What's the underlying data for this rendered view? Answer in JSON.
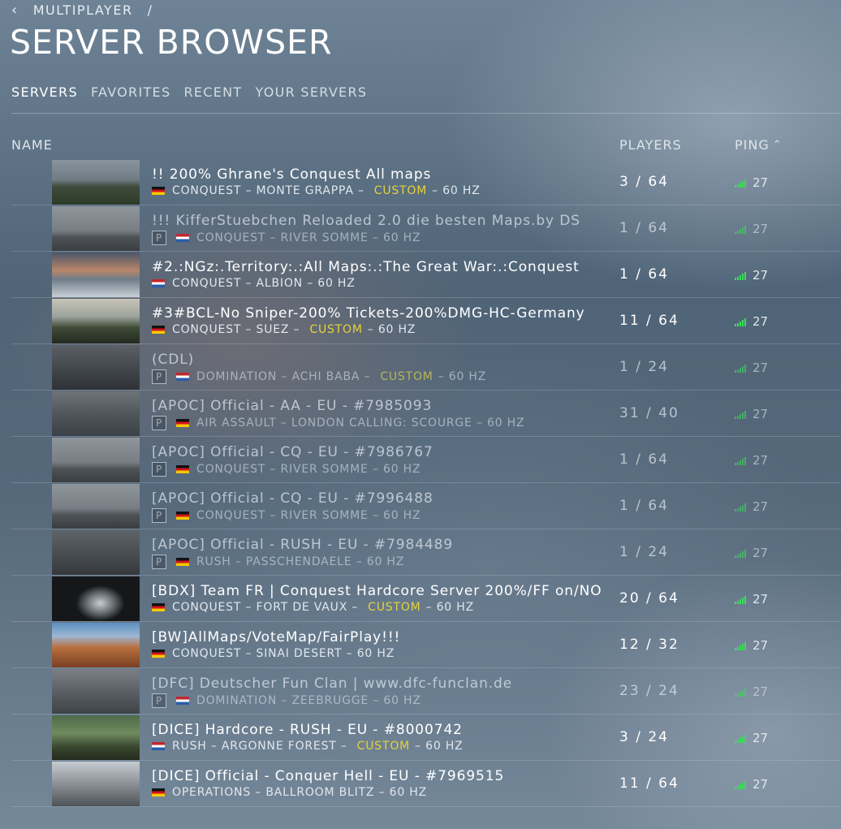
{
  "breadcrumb": {
    "back_icon": "chevron-left-icon",
    "label": "MULTIPLAYER",
    "separator": "/"
  },
  "page_title": "SERVER BROWSER",
  "tabs": [
    {
      "label": "SERVERS",
      "active": true
    },
    {
      "label": "FAVORITES",
      "active": false
    },
    {
      "label": "RECENT",
      "active": false
    },
    {
      "label": "YOUR SERVERS",
      "active": false
    }
  ],
  "columns": {
    "name": "NAME",
    "players": "PLAYERS",
    "ping": "PING",
    "ping_sort_icon": "chevron-up-icon"
  },
  "accent": {
    "custom": "#e6d23a",
    "ping_bars": "#3ddc5a"
  },
  "servers": [
    {
      "name": "!! 200% Ghrane's Conquest All maps",
      "p": false,
      "flag": "de",
      "mode": "CONQUEST",
      "map": "MONTE GRAPPA",
      "custom": "CUSTOM",
      "hz": "60 HZ",
      "players": "3 / 64",
      "ping": "27",
      "dim": false,
      "thumb": "linear-gradient(180deg,#8a949c 0%,#6f7a83 45%,#3f4a3a 60%,#2e3a2a 100%)"
    },
    {
      "name": "!!! KifferStuebchen Reloaded 2.0 die besten Maps.by DS",
      "p": true,
      "flag": "nl",
      "mode": "CONQUEST",
      "map": "RIVER SOMME",
      "custom": "",
      "hz": "60 HZ",
      "players": "1 / 64",
      "ping": "27",
      "dim": true,
      "thumb": "linear-gradient(180deg,#8e959b 0%,#777e84 55%,#4d5256 70%,#3a3e42 100%)"
    },
    {
      "name": "#2.:NGz:.Territory:.:All Maps:.:The Great War:.:Conquest",
      "p": false,
      "flag": "nl",
      "mode": "CONQUEST",
      "map": "ALBION",
      "custom": "",
      "hz": "60 HZ",
      "players": "1 / 64",
      "ping": "27",
      "dim": false,
      "thumb": "linear-gradient(180deg,#4a5668 0%,#b8866a 40%,#6f7d8a 60%,#c9d0d6 100%)"
    },
    {
      "name": "#3#BCL-No Sniper-200% Tickets-200%DMG-HC-Germany",
      "p": false,
      "flag": "de",
      "mode": "CONQUEST",
      "map": "SUEZ",
      "custom": "CUSTOM",
      "hz": "60 HZ",
      "players": "11 / 64",
      "ping": "27",
      "dim": false,
      "thumb": "linear-gradient(180deg,#c8c4b8 0%,#9aa39c 40%,#3f4a36 65%,#232a20 100%)"
    },
    {
      "name": "(CDL)",
      "p": true,
      "flag": "nl",
      "mode": "DOMINATION",
      "map": "ACHI BABA",
      "custom": "CUSTOM",
      "hz": "60 HZ",
      "players": "1 / 24",
      "ping": "27",
      "dim": true,
      "thumb": "linear-gradient(180deg,#5a6066 0%,#44494e 50%,#2e3236 100%)"
    },
    {
      "name": "[APOC] Official - AA - EU - #7985093",
      "p": true,
      "flag": "de",
      "mode": "AIR ASSAULT",
      "map": "LONDON CALLING: SCOURGE",
      "custom": "",
      "hz": "60 HZ",
      "players": "31 / 40",
      "ping": "27",
      "dim": true,
      "thumb": "linear-gradient(180deg,#6d747a 0%,#4f565c 50%,#3b4146 100%)"
    },
    {
      "name": "[APOC] Official - CQ - EU - #7986767",
      "p": true,
      "flag": "de",
      "mode": "CONQUEST",
      "map": "RIVER SOMME",
      "custom": "",
      "hz": "60 HZ",
      "players": "1 / 64",
      "ping": "27",
      "dim": true,
      "thumb": "linear-gradient(180deg,#8e959b 0%,#777e84 55%,#4d5256 70%,#3a3e42 100%)"
    },
    {
      "name": "[APOC] Official - CQ - EU - #7996488",
      "p": true,
      "flag": "de",
      "mode": "CONQUEST",
      "map": "RIVER SOMME",
      "custom": "",
      "hz": "60 HZ",
      "players": "1 / 64",
      "ping": "27",
      "dim": true,
      "thumb": "linear-gradient(180deg,#8e959b 0%,#777e84 55%,#4d5256 70%,#3a3e42 100%)"
    },
    {
      "name": "[APOC] Official - RUSH - EU - #7984489",
      "p": true,
      "flag": "de",
      "mode": "RUSH",
      "map": "PASSCHENDAELE",
      "custom": "",
      "hz": "60 HZ",
      "players": "1 / 24",
      "ping": "27",
      "dim": true,
      "thumb": "linear-gradient(180deg,#5e6468 0%,#4a4f53 50%,#35393c 100%)"
    },
    {
      "name": "[BDX] Team FR | Conquest Hardcore Server 200%/FF on/NO",
      "p": false,
      "flag": "de",
      "mode": "CONQUEST",
      "map": "FORT DE VAUX",
      "custom": "CUSTOM",
      "hz": "60 HZ",
      "players": "20 / 64",
      "ping": "27",
      "dim": false,
      "thumb": "radial-gradient(ellipse 30px 22px at 55% 60%,#c9ced2 0%,#5e6468 60%,#151719 100%)"
    },
    {
      "name": "[BW]AllMaps/VoteMap/FairPlay!!!",
      "p": false,
      "flag": "de",
      "mode": "CONQUEST",
      "map": "SINAI DESERT",
      "custom": "",
      "hz": "60 HZ",
      "players": "12 / 32",
      "ping": "27",
      "dim": false,
      "thumb": "linear-gradient(180deg,#5d8fc0 0%,#9cb7d2 30%,#b8703f 55%,#7a3f22 100%)"
    },
    {
      "name": "[DFC] Deutscher Fun Clan | www.dfc-funclan.de",
      "p": true,
      "flag": "nl",
      "mode": "DOMINATION",
      "map": "ZEEBRUGGE",
      "custom": "",
      "hz": "60 HZ",
      "players": "23 / 24",
      "ping": "27",
      "dim": true,
      "thumb": "linear-gradient(180deg,#7a8086 0%,#5a6066 50%,#3e4347 100%)"
    },
    {
      "name": "[DICE] Hardcore - RUSH - EU - #8000742",
      "p": false,
      "flag": "nl",
      "mode": "RUSH",
      "map": "ARGONNE FOREST",
      "custom": "CUSTOM",
      "hz": "60 HZ",
      "players": "3 / 24",
      "ping": "27",
      "dim": false,
      "thumb": "linear-gradient(180deg,#4e6a4a 0%,#6f8a5e 40%,#3a4a30 70%,#222a1c 100%)"
    },
    {
      "name": "[DICE] Official - Conquer Hell - EU - #7969515",
      "p": false,
      "flag": "de",
      "mode": "OPERATIONS",
      "map": "BALLROOM BLITZ",
      "custom": "",
      "hz": "60 HZ",
      "players": "11 / 64",
      "ping": "27",
      "dim": false,
      "thumb": "linear-gradient(180deg,#c6ccd2 0%,#8b9096 50%,#4e5358 100%)"
    }
  ]
}
